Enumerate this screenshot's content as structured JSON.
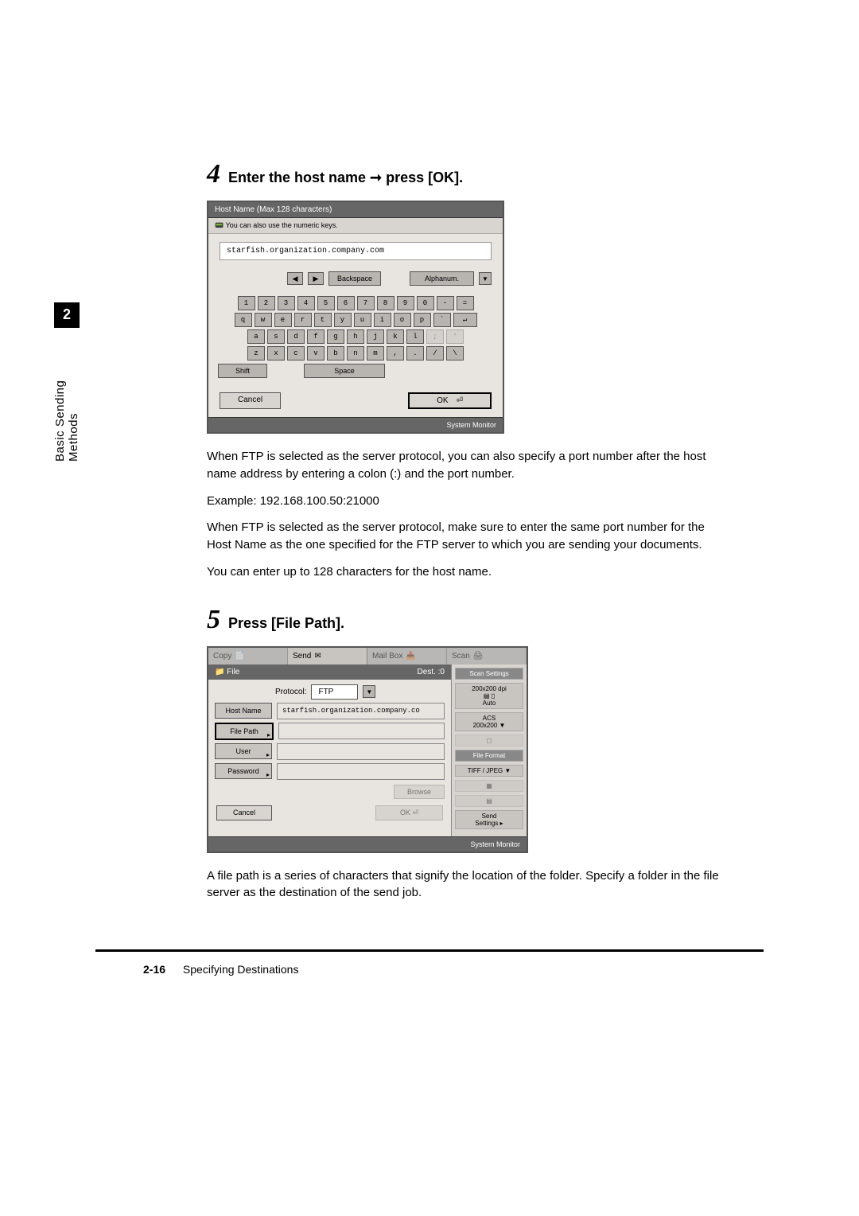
{
  "sidebar": {
    "chapter_number": "2",
    "chapter_title": "Basic Sending Methods"
  },
  "step4": {
    "number": "4",
    "title": "Enter the host name ➞ press [OK].",
    "screenshot": {
      "title": "Host Name (Max 128 characters)",
      "hint": "You can also use the numeric keys.",
      "input_value": "starfish.organization.company.com",
      "backspace": "Backspace",
      "mode": "Alphanum.",
      "shift": "Shift",
      "space": "Space",
      "cancel": "Cancel",
      "ok": "OK",
      "footer": "System Monitor",
      "row1": [
        "1",
        "2",
        "3",
        "4",
        "5",
        "6",
        "7",
        "8",
        "9",
        "0",
        "-",
        "="
      ],
      "row2": [
        "q",
        "w",
        "e",
        "r",
        "t",
        "y",
        "u",
        "i",
        "o",
        "p",
        "`",
        "↵"
      ],
      "row3": [
        "a",
        "s",
        "d",
        "f",
        "g",
        "h",
        "j",
        "k",
        "l",
        ";",
        "'"
      ],
      "row4": [
        "z",
        "x",
        "c",
        "v",
        "b",
        "n",
        "m",
        ",",
        ".",
        "/",
        "\\"
      ]
    },
    "paragraph1": "When FTP is selected as the server protocol, you can also specify a port number after the host name address by entering a colon (:) and the port number.",
    "paragraph2": "Example: 192.168.100.50:21000",
    "paragraph3": "When FTP is selected as the server protocol, make sure to enter the same port number for the Host Name as the one specified for the FTP server to which you are sending your documents.",
    "paragraph4": "You can enter up to 128 characters for the host name."
  },
  "step5": {
    "number": "5",
    "title": "Press [File Path].",
    "screenshot": {
      "tabs": {
        "copy": "Copy",
        "send": "Send",
        "mailbox": "Mail Box",
        "scan": "Scan"
      },
      "bar_label": "File",
      "dest_label": "Dest. :0",
      "protocol_label": "Protocol:",
      "protocol_value": "FTP",
      "hostname_label": "Host Name",
      "hostname_value": "starfish.organization.company.co",
      "filepath_label": "File Path",
      "user_label": "User",
      "password_label": "Password",
      "browse": "Browse",
      "cancel": "Cancel",
      "ok": "OK",
      "footer": "System Monitor",
      "right": {
        "scan_settings": "Scan Settings",
        "dpi": "200x200 dpi",
        "auto": "Auto",
        "acs": "ACS\n200x200",
        "file_format": "File Format",
        "format_value": "TIFF / JPEG",
        "send_settings": "Send\nSettings"
      }
    },
    "paragraph1": "A file path is a series of characters that signify the location of the folder. Specify a folder in the file server as the destination of the send job."
  },
  "footer": {
    "page": "2-16",
    "section": "Specifying Destinations"
  }
}
